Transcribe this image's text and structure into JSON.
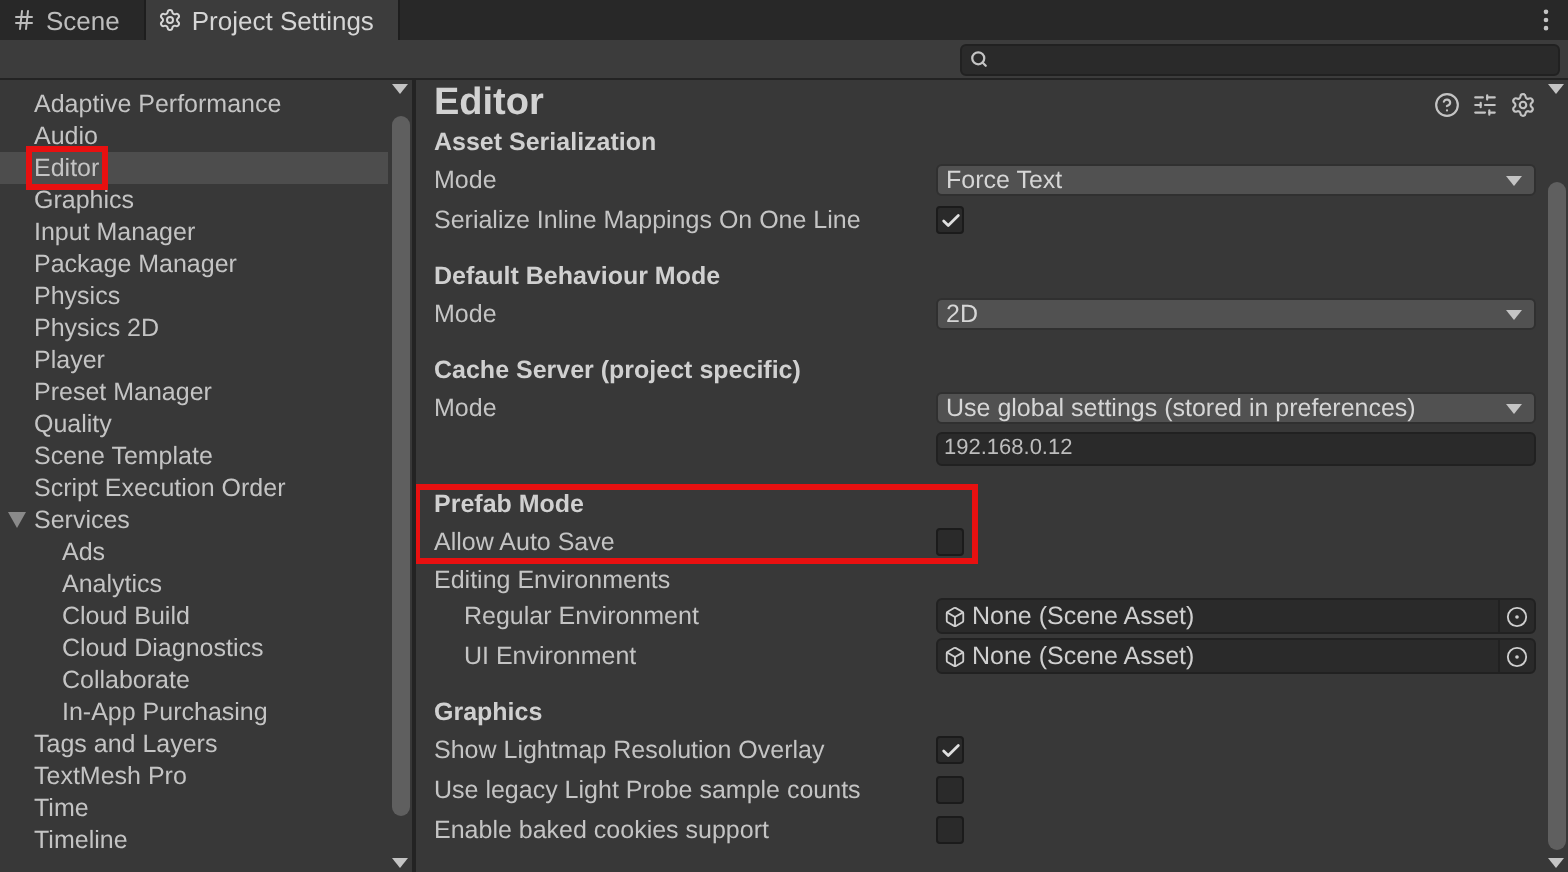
{
  "tabs": [
    {
      "label": "Scene",
      "selected": false
    },
    {
      "label": "Project Settings",
      "selected": true
    }
  ],
  "sidebar": {
    "items": [
      {
        "label": "Adaptive Performance",
        "selected": false,
        "highlighted": false
      },
      {
        "label": "Audio",
        "selected": false,
        "highlighted": false
      },
      {
        "label": "Editor",
        "selected": true,
        "highlighted": true
      },
      {
        "label": "Graphics",
        "selected": false,
        "highlighted": false
      },
      {
        "label": "Input Manager",
        "selected": false,
        "highlighted": false
      },
      {
        "label": "Package Manager",
        "selected": false,
        "highlighted": false
      },
      {
        "label": "Physics",
        "selected": false,
        "highlighted": false
      },
      {
        "label": "Physics 2D",
        "selected": false,
        "highlighted": false
      },
      {
        "label": "Player",
        "selected": false,
        "highlighted": false
      },
      {
        "label": "Preset Manager",
        "selected": false,
        "highlighted": false
      },
      {
        "label": "Quality",
        "selected": false,
        "highlighted": false
      },
      {
        "label": "Scene Template",
        "selected": false,
        "highlighted": false
      },
      {
        "label": "Script Execution Order",
        "selected": false,
        "highlighted": false
      },
      {
        "label": "Services",
        "selected": false,
        "highlighted": false,
        "expanded": true,
        "children": [
          {
            "label": "Ads",
            "selected": false,
            "highlighted": false
          },
          {
            "label": "Analytics",
            "selected": false,
            "highlighted": false
          },
          {
            "label": "Cloud Build",
            "selected": false,
            "highlighted": false
          },
          {
            "label": "Cloud Diagnostics",
            "selected": false,
            "highlighted": false
          },
          {
            "label": "Collaborate",
            "selected": false,
            "highlighted": false
          },
          {
            "label": "In-App Purchasing",
            "selected": false,
            "highlighted": false
          }
        ]
      },
      {
        "label": "Tags and Layers",
        "selected": false,
        "highlighted": false
      },
      {
        "label": "TextMesh Pro",
        "selected": false,
        "highlighted": false
      },
      {
        "label": "Time",
        "selected": false,
        "highlighted": false
      },
      {
        "label": "Timeline",
        "selected": false,
        "highlighted": false
      }
    ]
  },
  "page": {
    "title": "Editor",
    "sections": [
      {
        "title": "Asset Serialization",
        "highlighted": false,
        "rows": [
          {
            "kind": "dropdown",
            "label": "Mode",
            "value": "Force Text"
          },
          {
            "kind": "checkbox",
            "label": "Serialize Inline Mappings On One Line",
            "checked": true
          }
        ]
      },
      {
        "title": "Default Behaviour Mode",
        "highlighted": false,
        "rows": [
          {
            "kind": "dropdown",
            "label": "Mode",
            "value": "2D"
          }
        ]
      },
      {
        "title": "Cache Server (project specific)",
        "highlighted": false,
        "rows": [
          {
            "kind": "dropdown",
            "label": "Mode",
            "value": "Use global settings (stored in preferences)"
          },
          {
            "kind": "text",
            "value": "192.168.0.12"
          }
        ]
      },
      {
        "title": "Prefab Mode",
        "highlighted": true,
        "rows": [
          {
            "kind": "checkbox",
            "label": "Allow Auto Save",
            "checked": false
          }
        ]
      },
      {
        "highlighted": false,
        "rows": [
          {
            "kind": "group",
            "label": "Editing Environments",
            "children": [
              {
                "kind": "object",
                "label": "Regular Environment",
                "value": "None (Scene Asset)"
              },
              {
                "kind": "object",
                "label": "UI Environment",
                "value": "None (Scene Asset)"
              }
            ]
          }
        ]
      },
      {
        "title": "Graphics",
        "highlighted": false,
        "rows": [
          {
            "kind": "checkbox",
            "label": "Show Lightmap Resolution Overlay",
            "checked": true
          },
          {
            "kind": "checkbox",
            "label": "Use legacy Light Probe sample counts",
            "checked": false
          },
          {
            "kind": "checkbox",
            "label": "Enable baked cookies support",
            "checked": false
          }
        ]
      }
    ]
  }
}
